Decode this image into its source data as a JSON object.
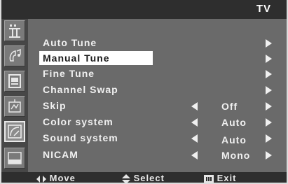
{
  "header": {
    "title": "TV"
  },
  "sidebar": {
    "items": [
      {
        "name": "picture-icon"
      },
      {
        "name": "sound-icon"
      },
      {
        "name": "channel-icon"
      },
      {
        "name": "setup-icon"
      },
      {
        "name": "input-icon"
      },
      {
        "name": "pip-icon"
      }
    ],
    "active_index": 3
  },
  "menu": {
    "items": [
      {
        "label": "Auto Tune",
        "value": "",
        "has_left_arrow": false,
        "selected": false
      },
      {
        "label": "Manual Tune",
        "value": "",
        "has_left_arrow": false,
        "selected": true
      },
      {
        "label": "Fine Tune",
        "value": "",
        "has_left_arrow": false,
        "selected": false
      },
      {
        "label": "Channel Swap",
        "value": "",
        "has_left_arrow": false,
        "selected": false
      },
      {
        "label": "Skip",
        "value": "Off",
        "has_left_arrow": true,
        "selected": false
      },
      {
        "label": "Color system",
        "value": "Auto",
        "has_left_arrow": true,
        "selected": false
      },
      {
        "label": "Sound system",
        "value": "Auto",
        "has_left_arrow": true,
        "selected": false
      },
      {
        "label": "NICAM",
        "value": "Mono",
        "has_left_arrow": true,
        "selected": false
      }
    ]
  },
  "footer": {
    "move_label": "Move",
    "select_label": "Select",
    "exit_label": "Exit"
  }
}
